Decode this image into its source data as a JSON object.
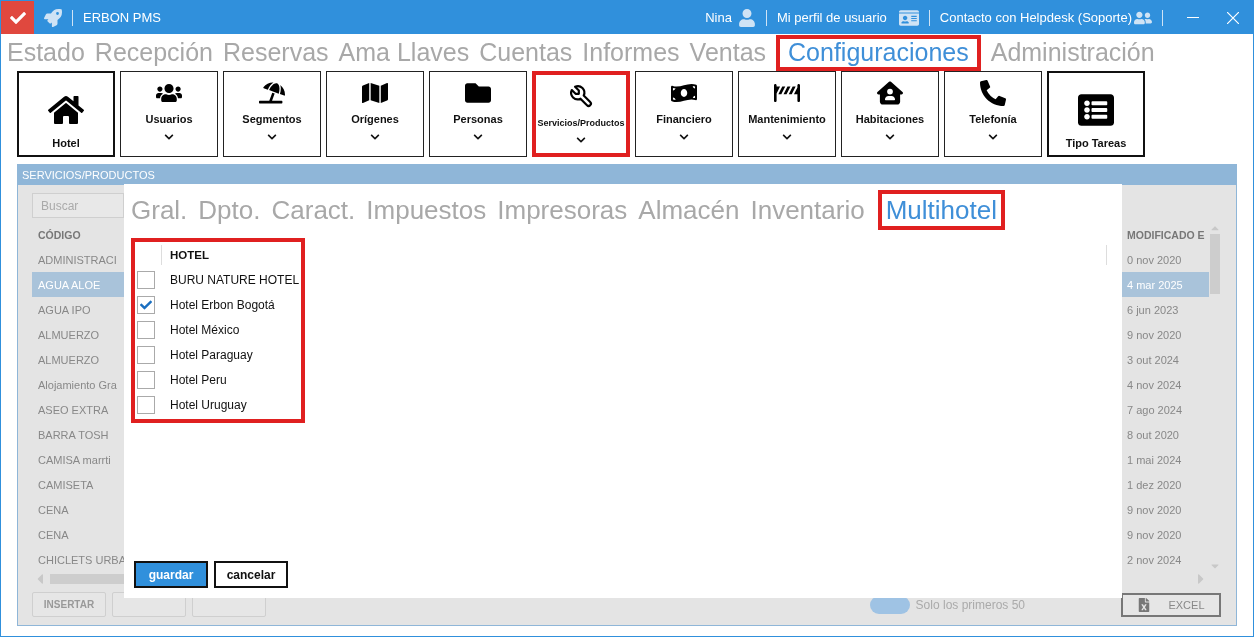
{
  "titlebar": {
    "title": "ERBON PMS",
    "user": "Nina",
    "profile": "Mi perfil de usuario",
    "helpdesk": "Contacto con Helpdesk (Soporte)"
  },
  "menu": [
    {
      "label": "Estado",
      "selected": false,
      "highlighted": false
    },
    {
      "label": "Recepción",
      "selected": false,
      "highlighted": false
    },
    {
      "label": "Reservas",
      "selected": false,
      "highlighted": false
    },
    {
      "label": "Ama Llaves",
      "selected": false,
      "highlighted": false
    },
    {
      "label": "Cuentas",
      "selected": false,
      "highlighted": false
    },
    {
      "label": "Informes",
      "selected": false,
      "highlighted": false
    },
    {
      "label": "Ventas",
      "selected": false,
      "highlighted": false
    },
    {
      "label": "Configuraciones",
      "selected": true,
      "highlighted": true
    },
    {
      "label": "Administración",
      "selected": false,
      "highlighted": false
    }
  ],
  "toolbar": [
    {
      "label": "Hotel",
      "kind": "single",
      "highlighted": false
    },
    {
      "label": "Usuarios",
      "kind": "menu",
      "highlighted": false
    },
    {
      "label": "Segmentos",
      "kind": "menu",
      "highlighted": false
    },
    {
      "label": "Orígenes",
      "kind": "menu",
      "highlighted": false
    },
    {
      "label": "Personas",
      "kind": "menu",
      "highlighted": false
    },
    {
      "label": "Servicios/Productos",
      "kind": "menu",
      "highlighted": true
    },
    {
      "label": "Financiero",
      "kind": "menu",
      "highlighted": false
    },
    {
      "label": "Mantenimiento",
      "kind": "menu",
      "highlighted": false
    },
    {
      "label": "Habitaciones",
      "kind": "menu",
      "highlighted": false
    },
    {
      "label": "Telefonía",
      "kind": "menu",
      "highlighted": false
    },
    {
      "label": "Tipo Tareas",
      "kind": "single",
      "highlighted": false
    }
  ],
  "panel": {
    "title": "SERVICIOS/PRODUCTOS",
    "search": {
      "placeholder": "Buscar"
    },
    "columns": [
      "CÓDIGO",
      "MODIFICADO E"
    ],
    "rows": [
      {
        "code": "ADMINISTRACI",
        "modified": "0 nov 2020",
        "selected": false
      },
      {
        "code": "AGUA ALOE",
        "modified": "4 mar 2025",
        "selected": true
      },
      {
        "code": "AGUA IPO",
        "modified": "6 jun 2023",
        "selected": false
      },
      {
        "code": "ALMUERZO",
        "modified": "9 nov 2020",
        "selected": false
      },
      {
        "code": "ALMUERZO",
        "modified": "3 out 2024",
        "selected": false
      },
      {
        "code": "Alojamiento Gra",
        "modified": "4 nov 2024",
        "selected": false
      },
      {
        "code": "ASEO EXTRA",
        "modified": "7 ago 2024",
        "selected": false
      },
      {
        "code": "BARRA TOSH",
        "modified": "8 out 2020",
        "selected": false
      },
      {
        "code": "CAMISA  marrti",
        "modified": "1 mai 2024",
        "selected": false
      },
      {
        "code": "CAMISETA",
        "modified": "1 dez 2020",
        "selected": false
      },
      {
        "code": "CENA",
        "modified": "9 nov 2020",
        "selected": false
      },
      {
        "code": "CENA",
        "modified": "9 nov 2020",
        "selected": false
      },
      {
        "code": "CHICLETS URBA",
        "modified": "2 nov 2024",
        "selected": false
      }
    ],
    "insert_button": "INSERTAR",
    "limit_label": "Solo los primeros 50",
    "limit_on": true,
    "excel_button": "EXCEL"
  },
  "dialog": {
    "tabs": [
      {
        "label": "Gral.",
        "selected": false,
        "highlighted": false
      },
      {
        "label": "Dpto.",
        "selected": false,
        "highlighted": false
      },
      {
        "label": "Caract.",
        "selected": false,
        "highlighted": false
      },
      {
        "label": "Impuestos",
        "selected": false,
        "highlighted": false
      },
      {
        "label": "Impresoras",
        "selected": false,
        "highlighted": false
      },
      {
        "label": "Almacén",
        "selected": false,
        "highlighted": false
      },
      {
        "label": "Inventario",
        "selected": false,
        "highlighted": false
      },
      {
        "label": "Multihotel",
        "selected": true,
        "highlighted": true
      }
    ],
    "table_highlighted": true,
    "column": "HOTEL",
    "hotels": [
      {
        "name": "BURU NATURE HOTEL",
        "checked": false
      },
      {
        "name": "Hotel Erbon Bogotá",
        "checked": true
      },
      {
        "name": "Hotel México",
        "checked": false
      },
      {
        "name": "Hotel Paraguay",
        "checked": false
      },
      {
        "name": "Hotel Peru",
        "checked": false
      },
      {
        "name": "Hotel Uruguay",
        "checked": false
      }
    ],
    "save": "guardar",
    "cancel": "cancelar"
  }
}
